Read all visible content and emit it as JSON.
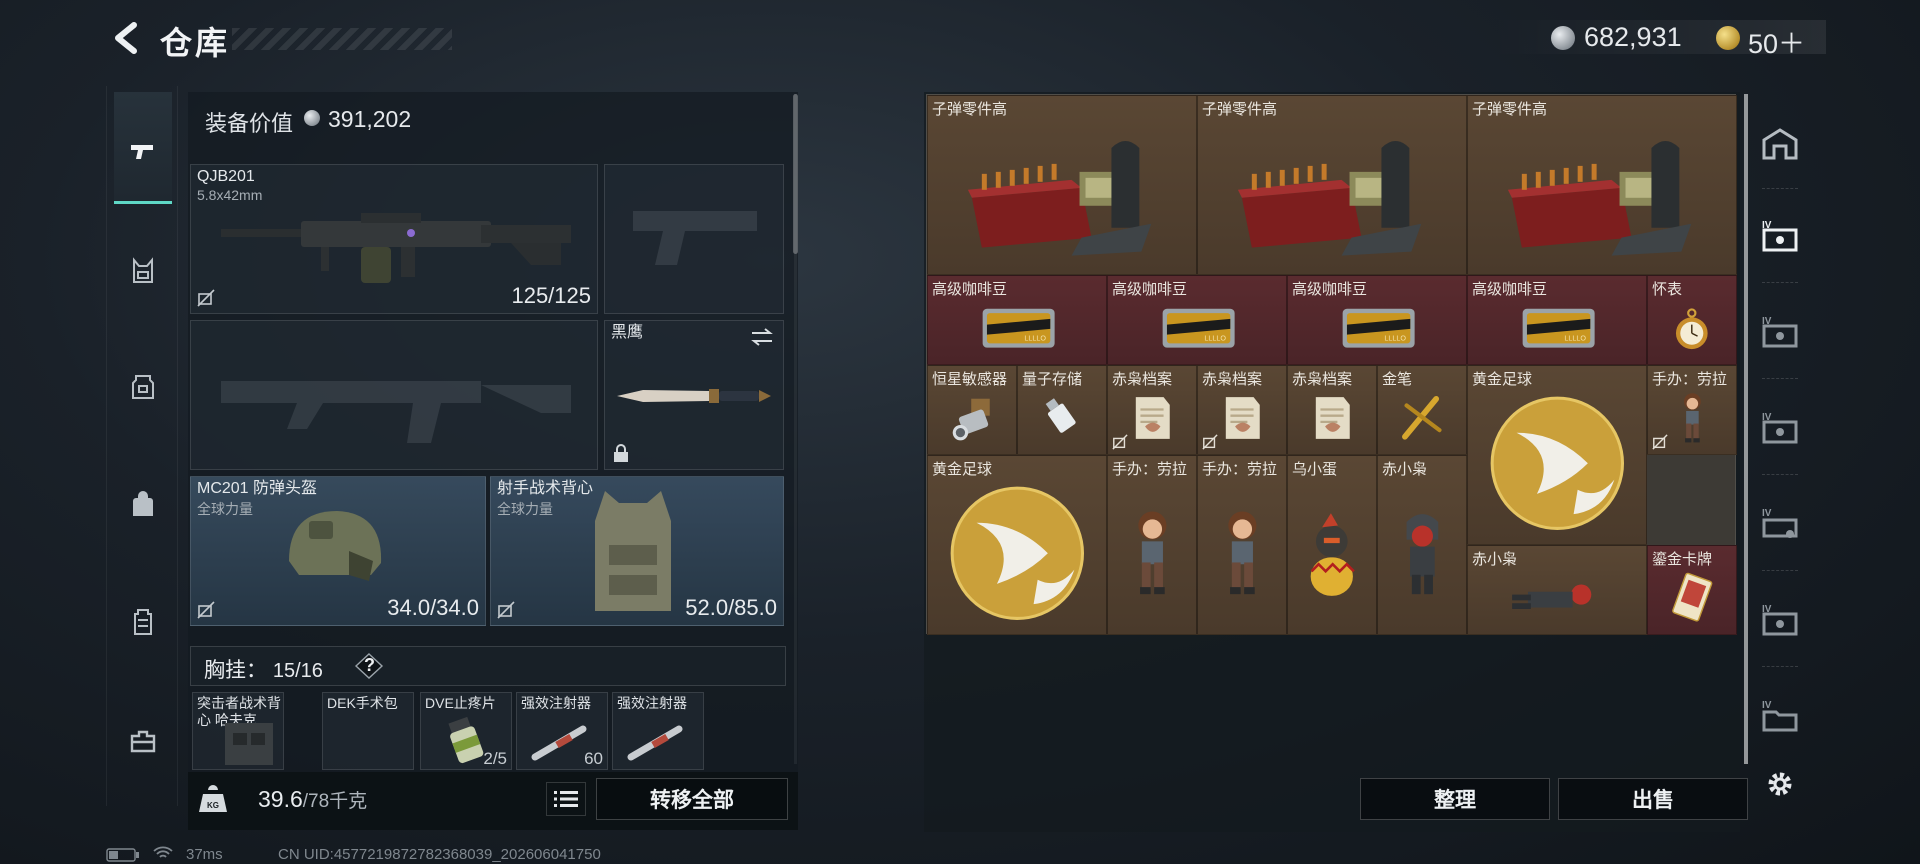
{
  "header": {
    "title": "仓库"
  },
  "currency": {
    "silver": "682,931",
    "gold": "50＋"
  },
  "loadout": {
    "value_label": "装备价值",
    "value": "391,202",
    "primary": {
      "name": "QJB201",
      "ammo": "5.8x42mm",
      "durability": "125/125"
    },
    "melee": {
      "name": "黑鹰"
    },
    "helmet": {
      "name": "MC201 防弹头盔",
      "sub": "全球力量",
      "durability": "34.0/34.0"
    },
    "vest": {
      "name": "射手战术背心",
      "sub": "全球力量",
      "durability": "52.0/85.0"
    },
    "chest": {
      "label": "胸挂：",
      "capacity": "15/16",
      "help": "?"
    },
    "chest_items": [
      {
        "name": "突击者战术背心 哈夫克",
        "count": ""
      },
      {
        "name": "DEK手术包",
        "count": ""
      },
      {
        "name": "DVE止疼片",
        "count": "2/5"
      },
      {
        "name": "强效注射器",
        "count": "60"
      },
      {
        "name": "强效注射器",
        "count": ""
      }
    ],
    "weight": "39.6",
    "weight_max": "/78千克",
    "transfer_label": "转移全部"
  },
  "storage": {
    "items": [
      {
        "name": "子弹零件高",
        "bg": "gold",
        "art": "ammo-crate"
      },
      {
        "name": "子弹零件高",
        "bg": "gold",
        "art": "ammo-crate"
      },
      {
        "name": "子弹零件高",
        "bg": "gold",
        "art": "ammo-crate"
      },
      {
        "name": "高级咖啡豆",
        "bg": "red",
        "art": "coffee-tin"
      },
      {
        "name": "高级咖啡豆",
        "bg": "red",
        "art": "coffee-tin"
      },
      {
        "name": "高级咖啡豆",
        "bg": "red",
        "art": "coffee-tin"
      },
      {
        "name": "高级咖啡豆",
        "bg": "red",
        "art": "coffee-tin"
      },
      {
        "name": "怀表",
        "bg": "red",
        "art": "pocket-watch"
      },
      {
        "name": "恒星敏感器",
        "bg": "gold",
        "art": "sensor"
      },
      {
        "name": "量子存储",
        "bg": "gold",
        "art": "usb-drive"
      },
      {
        "name": "赤枭档案",
        "bg": "gold",
        "art": "file"
      },
      {
        "name": "赤枭档案",
        "bg": "gold",
        "art": "file"
      },
      {
        "name": "赤枭档案",
        "bg": "gold",
        "art": "file"
      },
      {
        "name": "金笔",
        "bg": "gold",
        "art": "gold-pen"
      },
      {
        "name": "黄金足球",
        "bg": "gold",
        "art": "gold-ball"
      },
      {
        "name": "手办：劳拉",
        "bg": "gold",
        "art": "figure-lara"
      },
      {
        "name": "黄金足球",
        "bg": "gold",
        "art": "gold-ball"
      },
      {
        "name": "手办：劳拉",
        "bg": "gold",
        "art": "figure-lara"
      },
      {
        "name": "手办：劳拉",
        "bg": "gold",
        "art": "figure-lara"
      },
      {
        "name": "乌小蛋",
        "bg": "gold",
        "art": "egg-figure"
      },
      {
        "name": "赤小枭",
        "bg": "gold",
        "art": "red-figure"
      },
      {
        "name": "赤小枭",
        "bg": "gold",
        "art": "red-figure-lying"
      },
      {
        "name": "鎏金卡牌",
        "bg": "red",
        "art": "gold-card"
      }
    ],
    "tidy_label": "整理",
    "sell_label": "出售"
  },
  "status": {
    "ping": "37ms",
    "uid": "CN UID:4577219872782368039_202606041750"
  },
  "colors": {
    "accent": "#5fd8c6",
    "cell_gold": "#4a3a2b",
    "cell_red": "#4a2428"
  }
}
